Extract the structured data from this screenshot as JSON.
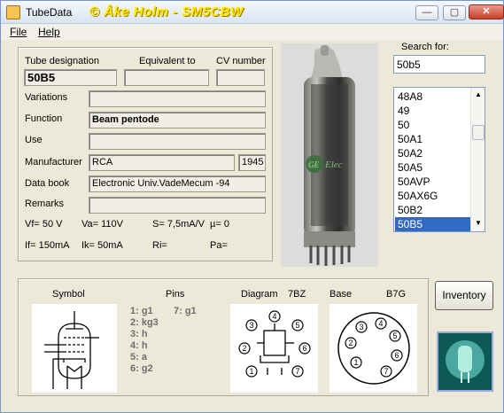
{
  "window": {
    "title": "TubeData",
    "banner": "© Åke Holm - SM5CBW",
    "minimize_glyph": "—",
    "maximize_glyph": "▢",
    "close_glyph": "✕"
  },
  "menu": {
    "file": "File",
    "help": "Help"
  },
  "fields": {
    "tube_designation_label": "Tube designation",
    "tube_designation_value": "50B5",
    "equivalent_label": "Equivalent to",
    "equivalent_value": "",
    "cv_label": "CV number",
    "cv_value": "",
    "variations_label": "Variations",
    "variations_value": "",
    "function_label": "Function",
    "function_value": "Beam pentode",
    "use_label": "Use",
    "use_value": "",
    "manufacturer_label": "Manufacturer",
    "manufacturer_value": "RCA",
    "year_value": "1945",
    "databook_label": "Data book",
    "databook_value": "Electronic Univ.VadeMecum -94",
    "remarks_label": "Remarks",
    "remarks_value": ""
  },
  "specs": {
    "vf": "Vf= 50 V",
    "va": "Va= 110V",
    "s": "S= 7,5mA/V",
    "mu": "µ=   0",
    "if": "If= 150mA",
    "ik": "Ik=  50mA",
    "ri": "Ri=",
    "pa": "Pa="
  },
  "search": {
    "label": "Search for:",
    "value": "50b5",
    "items": [
      "48A8",
      "49",
      "50",
      "50A1",
      "50A2",
      "50A5",
      "50AVP",
      "50AX6G",
      "50B2",
      "50B5"
    ],
    "selected": "50B5",
    "scroll_up": "▲",
    "scroll_down": "▼"
  },
  "bottom": {
    "symbol_label": "Symbol",
    "pins_label": "Pins",
    "pins_left": [
      "1: g1",
      "2: kg3",
      "3: h",
      "4: h",
      "5: a",
      "6: g2"
    ],
    "pins_right": [
      "7: g1"
    ],
    "diagram_label": "Diagram",
    "diagram_code": "7BZ",
    "base_label": "Base",
    "base_code": "B7G",
    "diagram_pins": [
      "1",
      "2",
      "3",
      "4",
      "5",
      "6",
      "7"
    ],
    "base_pins": [
      "1",
      "2",
      "3",
      "4",
      "5",
      "6",
      "7"
    ]
  },
  "inventory_button": "Inventory",
  "photo_label": "GE"
}
